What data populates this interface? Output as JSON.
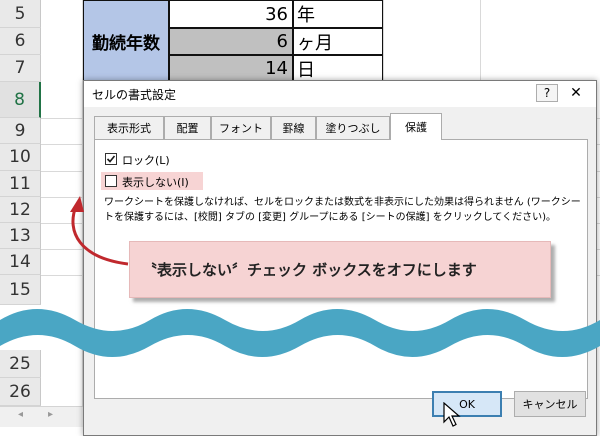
{
  "spreadsheet": {
    "row_numbers": [
      "5",
      "6",
      "7",
      "8",
      "9",
      "10",
      "11",
      "12",
      "13",
      "14",
      "15",
      "25",
      "26"
    ],
    "merged_label": "勤続年数",
    "values": [
      {
        "num": "36",
        "unit": "年"
      },
      {
        "num": "6",
        "unit": "ヶ月"
      },
      {
        "num": "14",
        "unit": "日"
      }
    ]
  },
  "dialog": {
    "title": "セルの書式設定",
    "help_glyph": "?",
    "close_glyph": "✕",
    "tabs": [
      "表示形式",
      "配置",
      "フォント",
      "罫線",
      "塗りつぶし",
      "保護"
    ],
    "active_tab": "保護",
    "lock_label": "ロック(L)",
    "lock_checked": true,
    "hidden_label": "表示しない(I)",
    "hidden_checked": false,
    "description": "ワークシートを保護しなければ、セルをロックまたは数式を非表示にした効果は得られません (ワークシートを保護するには、[校閲] タブの [変更] グループにある [シートの保護] をクリックしてください)。",
    "ok_label": "OK",
    "cancel_label": "キャンセル"
  },
  "callout": {
    "text": "〝表示しない〞チェック ボックスをオフにします"
  },
  "colors": {
    "merged_cell_fill": "#b4c6e7",
    "shaded_cell_fill": "#c0c0c0",
    "callout_fill": "#f6d3d3",
    "wave_color": "#4aa6c4",
    "arrow_color": "#c0282d"
  }
}
